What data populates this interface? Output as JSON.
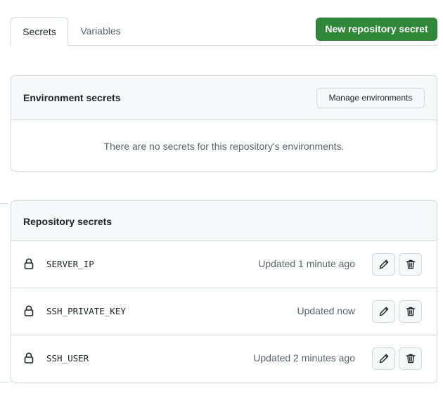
{
  "tabs": [
    {
      "label": "Secrets",
      "active": true
    },
    {
      "label": "Variables",
      "active": false
    }
  ],
  "actions": {
    "new_secret_label": "New repository secret",
    "primary_color": "#2f8838"
  },
  "environment_secrets": {
    "title": "Environment secrets",
    "manage_label": "Manage environments",
    "empty_message": "There are no secrets for this repository's environments."
  },
  "repository_secrets": {
    "title": "Repository secrets",
    "items": [
      {
        "name": "SERVER_IP",
        "updated": "Updated 1 minute ago",
        "icon": "lock-icon"
      },
      {
        "name": "SSH_PRIVATE_KEY",
        "updated": "Updated now",
        "icon": "lock-icon"
      },
      {
        "name": "SSH_USER",
        "updated": "Updated 2 minutes ago",
        "icon": "lock-icon"
      }
    ]
  }
}
